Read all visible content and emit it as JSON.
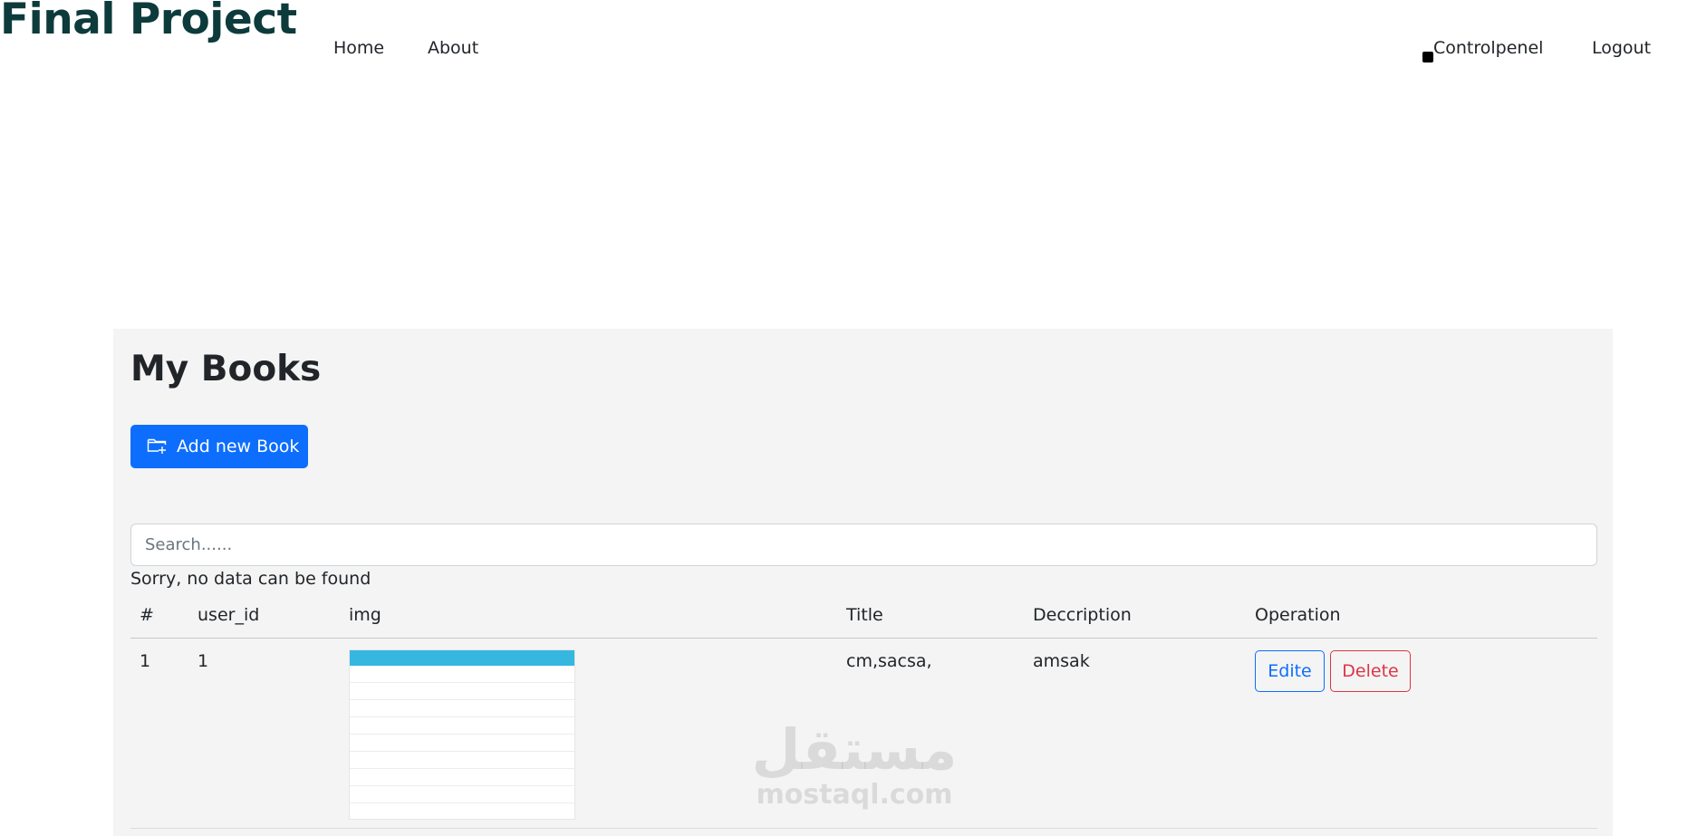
{
  "header": {
    "brand": "Final Project",
    "nav": {
      "home": "Home",
      "about": "About",
      "controlpanel": "Controlpenel",
      "logout": "Logout"
    }
  },
  "main": {
    "title": "My Books",
    "add_button_label": "Add new Book",
    "search_placeholder": "Search......",
    "empty_message": "Sorry, no data can be found",
    "columns": [
      "#",
      "user_id",
      "img",
      "Title",
      "Deccription",
      "Operation"
    ],
    "rows": [
      {
        "index": "1",
        "user_id": "1",
        "title": "cm,sacsa,",
        "description": "amsak",
        "edit_label": "Edite",
        "delete_label": "Delete"
      }
    ]
  },
  "watermark": {
    "arabic": "مستقل",
    "latin": "mostaql.com"
  },
  "colors": {
    "brand": "#0d3b3b",
    "primary": "#0d6efd",
    "danger": "#dc3545",
    "panel": "#f4f4f4"
  },
  "icons": {
    "add_button": "folder-plus-icon",
    "controlpanel": "square-icon"
  }
}
